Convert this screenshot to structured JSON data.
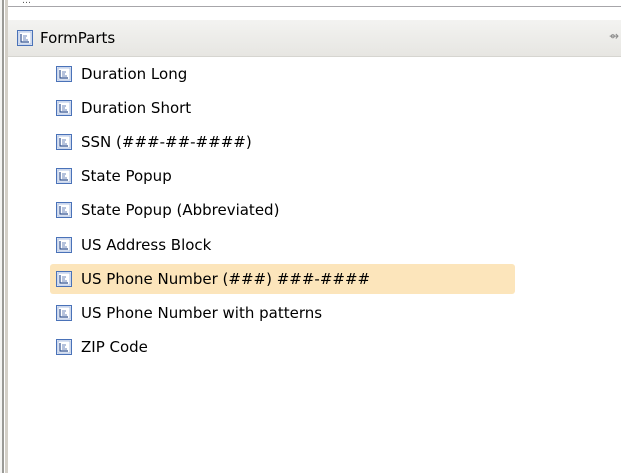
{
  "panel": {
    "group_label": "FormParts",
    "collapse_glyph": "⇴",
    "top_dots": "…"
  },
  "items": [
    {
      "label": "Duration Long",
      "icon": "form-part-icon",
      "selected": false
    },
    {
      "label": "Duration Short",
      "icon": "form-part-icon",
      "selected": false
    },
    {
      "label": "SSN (###-##-####)",
      "icon": "form-part-icon",
      "selected": false
    },
    {
      "label": "State Popup",
      "icon": "form-part-icon",
      "selected": false
    },
    {
      "label": "State Popup (Abbreviated)",
      "icon": "form-part-icon",
      "selected": false
    },
    {
      "label": "US Address Block",
      "icon": "form-part-icon",
      "selected": false
    },
    {
      "label": "US Phone Number (###) ###-####",
      "icon": "form-part-icon",
      "selected": true
    },
    {
      "label": "US Phone Number with patterns",
      "icon": "form-part-icon",
      "selected": false
    },
    {
      "label": "ZIP Code",
      "icon": "form-part-icon",
      "selected": false
    }
  ],
  "colors": {
    "selection": "#fce5bb",
    "icon_border": "#4a72b8",
    "icon_fill": "#e8eef8"
  }
}
